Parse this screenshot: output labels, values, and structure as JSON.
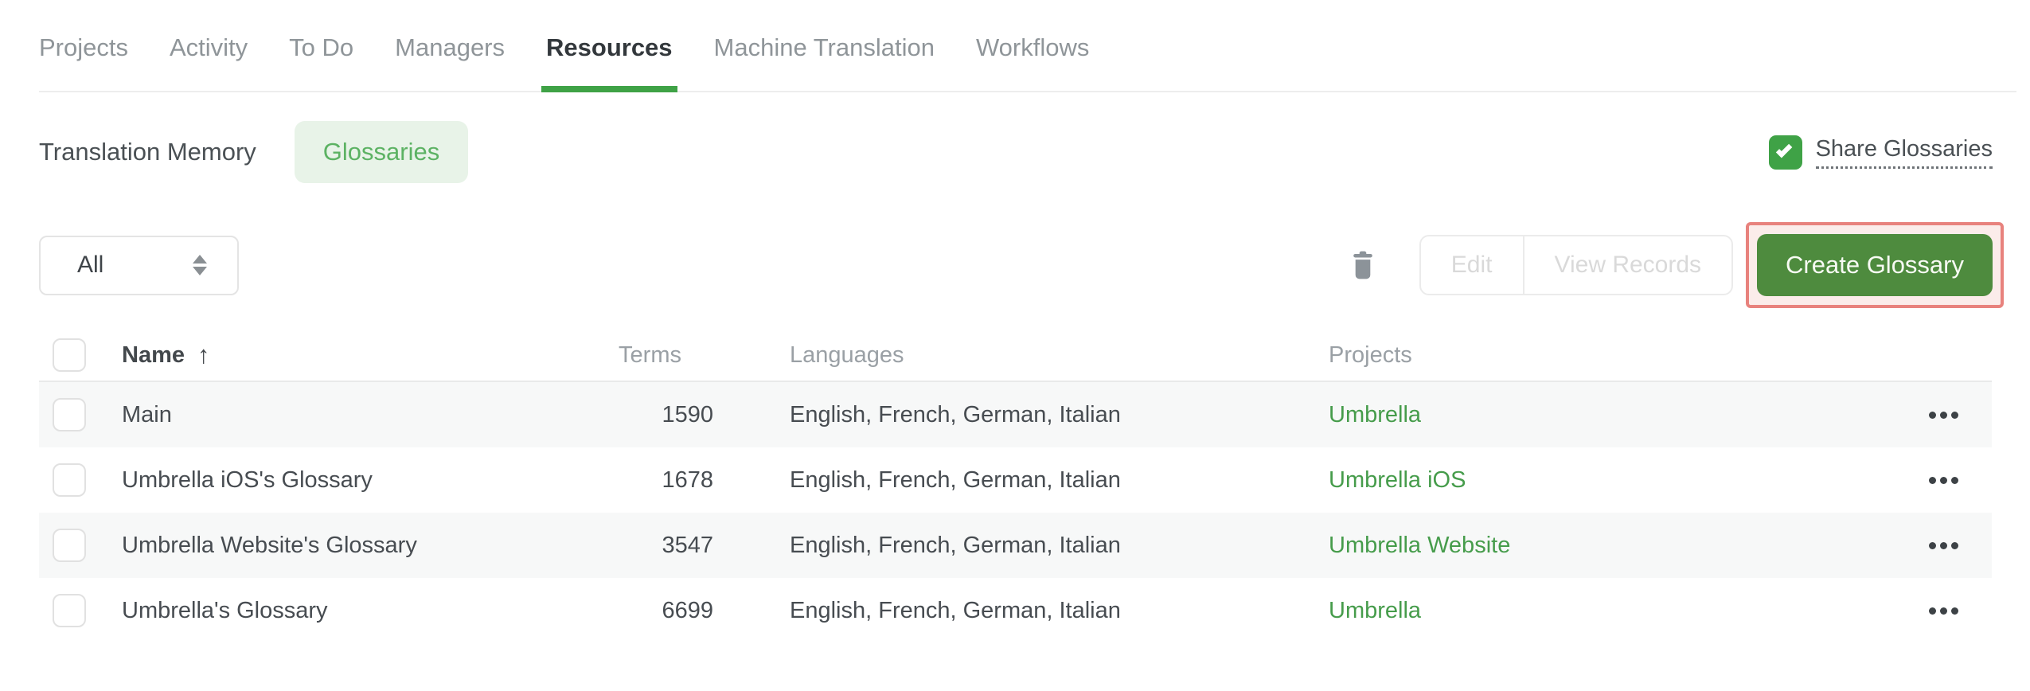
{
  "nav_tabs": [
    {
      "label": "Projects",
      "active": false
    },
    {
      "label": "Activity",
      "active": false
    },
    {
      "label": "To Do",
      "active": false
    },
    {
      "label": "Managers",
      "active": false
    },
    {
      "label": "Resources",
      "active": true
    },
    {
      "label": "Machine Translation",
      "active": false
    },
    {
      "label": "Workflows",
      "active": false
    }
  ],
  "subnav": {
    "translation_memory_label": "Translation Memory",
    "glossaries_label": "Glossaries",
    "active_subtab": "Glossaries"
  },
  "share_glossaries": {
    "label": "Share Glossaries",
    "checked": true,
    "icon": "checkmark-icon"
  },
  "toolbar": {
    "filter": {
      "value": "All",
      "icon": "up-down-arrows-icon"
    },
    "delete_icon": "trash-icon",
    "edit_label": "Edit",
    "view_records_label": "View Records",
    "edit_disabled": true,
    "view_records_disabled": true,
    "create_glossary_label": "Create Glossary",
    "create_glossary_highlighted": true
  },
  "table": {
    "headers": {
      "name": "Name",
      "terms": "Terms",
      "languages": "Languages",
      "projects": "Projects"
    },
    "sort": {
      "column": "Name",
      "direction": "ascending",
      "icon": "arrow-up-icon"
    },
    "row_menu_icon": "kebab-menu-icon",
    "rows": [
      {
        "name": "Main",
        "terms": "1590",
        "languages": "English, French, German, Italian",
        "project": "Umbrella",
        "checked": false
      },
      {
        "name": "Umbrella iOS's Glossary",
        "terms": "1678",
        "languages": "English, French, German, Italian",
        "project": "Umbrella iOS",
        "checked": false
      },
      {
        "name": "Umbrella Website's Glossary",
        "terms": "3547",
        "languages": "English, French, German, Italian",
        "project": "Umbrella Website",
        "checked": false
      },
      {
        "name": "Umbrella's Glossary",
        "terms": "6699",
        "languages": "English, French, German, Italian",
        "project": "Umbrella",
        "checked": false
      }
    ]
  },
  "colors": {
    "accent_green": "#3fa246",
    "button_green": "#4e8b3e",
    "link_green": "#469c4b",
    "pill_bg": "#e8f3e8",
    "pill_text": "#5cb263",
    "highlight_border": "#e8827d",
    "highlight_bg": "#fbecea",
    "row_stripe": "#f7f8f8",
    "disabled_text": "#d9d9d9"
  }
}
